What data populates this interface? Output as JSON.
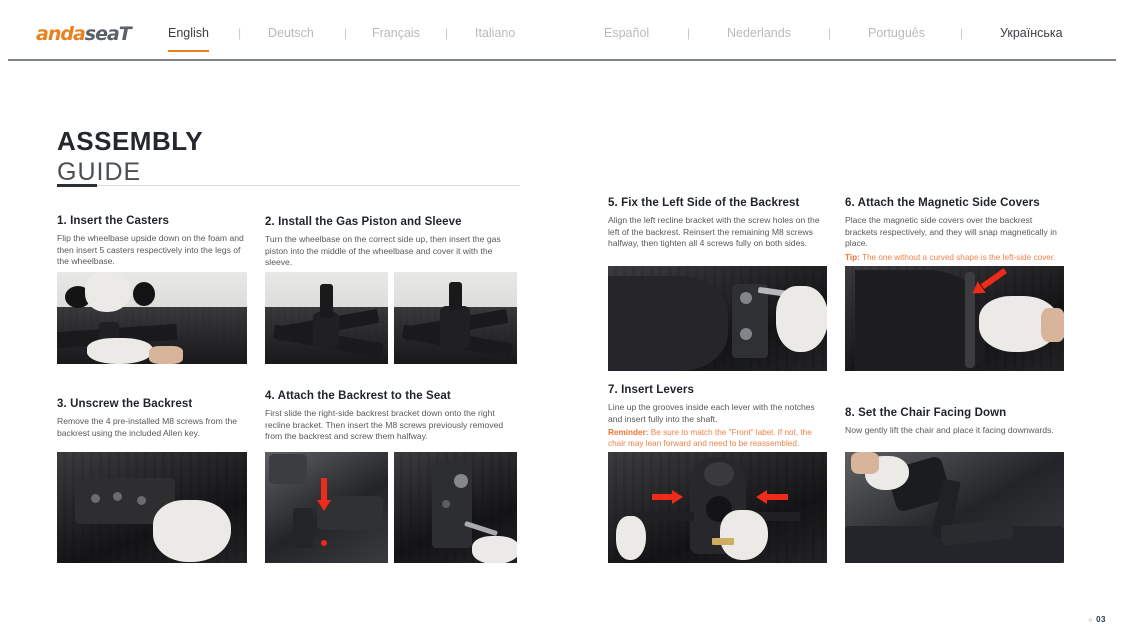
{
  "brand": {
    "name_part1": "anda",
    "name_part2": "seaT"
  },
  "nav": {
    "languages": [
      {
        "label": "English",
        "active": true
      },
      {
        "label": "Deutsch",
        "active": false
      },
      {
        "label": "Français",
        "active": false
      },
      {
        "label": "Italiano",
        "active": false
      },
      {
        "label": "Español",
        "active": false
      },
      {
        "label": "Nederlands",
        "active": false
      },
      {
        "label": "Português",
        "active": false
      },
      {
        "label": "Українська",
        "active": false
      }
    ],
    "separator": "|",
    "active_underline_color": "#e8821e"
  },
  "title": {
    "line1": "ASSEMBLY",
    "line2": "GUIDE"
  },
  "steps": [
    {
      "heading": "1. Insert the Casters",
      "body": "Flip the wheelbase upside down on the foam and then insert 5 casters respectively into the legs of the wheelbase."
    },
    {
      "heading": "2. Install the Gas Piston and Sleeve",
      "body": "Turn the wheelbase on the correct side up, then insert the gas piston into the middle of the wheelbase and cover it with the sleeve."
    },
    {
      "heading": "3. Unscrew the Backrest",
      "body": "Remove the 4 pre-installed M8 screws from the backrest using the included Allen key."
    },
    {
      "heading": "4. Attach the Backrest to the Seat",
      "body": "First slide the right-side backrest bracket down onto the right recline bracket. Then insert the M8 screws previously removed from the backrest and screw them halfway."
    },
    {
      "heading": "5. Fix the Left Side of the Backrest",
      "body": "Align the left recline bracket with the screw holes on the left of the backrest. Reinsert the remaining M8 screws halfway, then tighten all 4 screws fully on both sides."
    },
    {
      "heading": "6. Attach the Magnetic Side Covers",
      "body": "Place the magnetic side covers over the backrest brackets respectively, and they will snap magnetically in place.",
      "note_label": "Tip:",
      "note_text": " The one without a curved shape is the left-side cover."
    },
    {
      "heading": "7. Insert Levers",
      "body": "Line up the grooves inside each lever with the notches and insert fully into the shaft.",
      "note_label": "Reminder:",
      "note_text": " Be sure to match the \"Front\" label. If not, the chair may lean forward and need to be reassembled."
    },
    {
      "heading": "8. Set the Chair Facing Down",
      "body": "Now gently lift the chair and place it facing downwards."
    }
  ],
  "footer": {
    "chevron": "»",
    "page_number": "03"
  },
  "colors": {
    "brand_orange": "#e8821e",
    "note_orange": "#f0824a",
    "arrow_red": "#ee2b18",
    "heading_dark": "#1f2327",
    "body_gray": "#55595d"
  }
}
